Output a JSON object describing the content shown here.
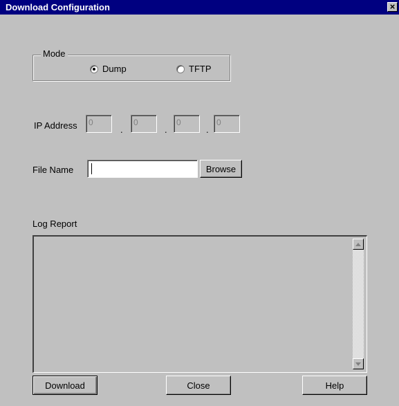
{
  "window": {
    "title": "Download Configuration",
    "close_symbol": "×"
  },
  "mode": {
    "legend": "Mode",
    "options": [
      {
        "label": "Dump",
        "checked": true
      },
      {
        "label": "TFTP",
        "checked": false
      }
    ]
  },
  "ip": {
    "label": "IP Address",
    "octets": [
      "0",
      "0",
      "0",
      "0"
    ],
    "separator": "."
  },
  "file": {
    "label": "File Name",
    "value": "",
    "browse_label": "Browse"
  },
  "log": {
    "label": "Log Report",
    "content": ""
  },
  "buttons": {
    "download": "Download",
    "close": "Close",
    "help": "Help"
  },
  "icons": {
    "scroll_up": "scroll-up-arrow-icon",
    "scroll_down": "scroll-down-arrow-icon"
  }
}
